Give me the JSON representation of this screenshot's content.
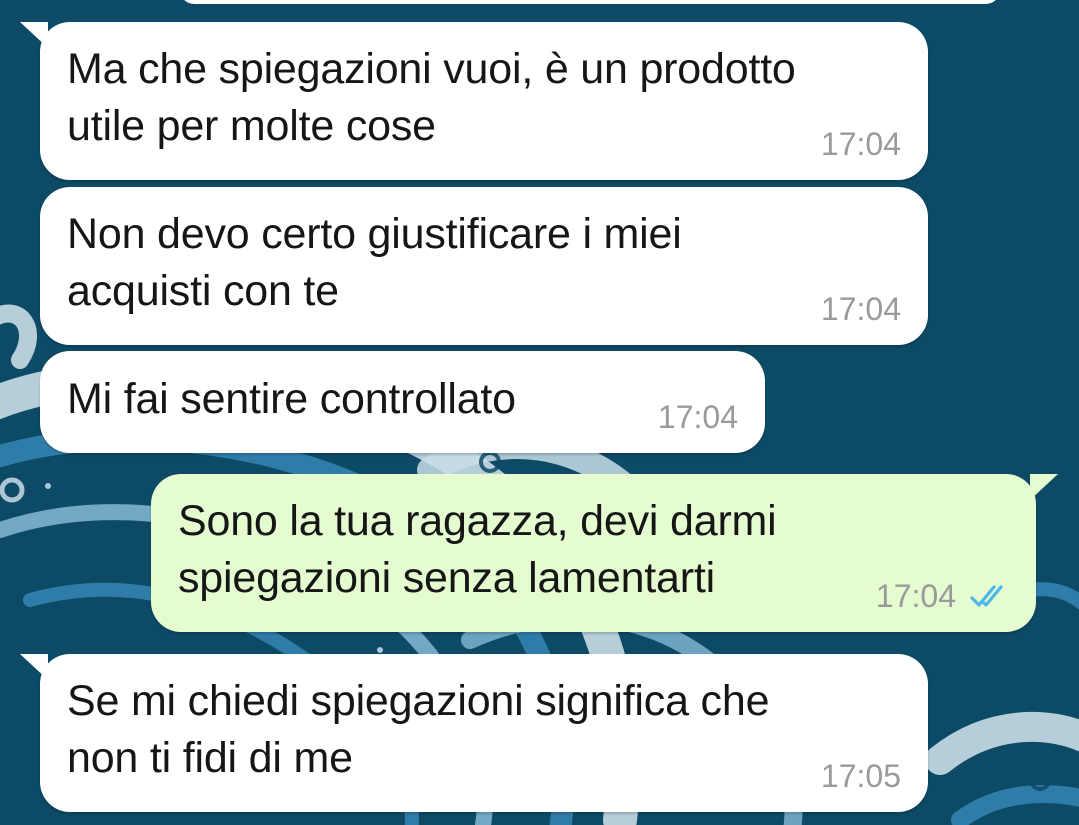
{
  "chat": {
    "messages": [
      {
        "direction": "incoming",
        "text": "Ma che spiegazioni vuoi, è un prodotto\nutile per molte cose",
        "time": "17:04"
      },
      {
        "direction": "incoming",
        "text": "Non devo certo giustificare i miei\nacquisti con te",
        "time": "17:04"
      },
      {
        "direction": "incoming",
        "text": "Mi fai sentire controllato",
        "time": "17:04"
      },
      {
        "direction": "outgoing",
        "text": "Sono la tua ragazza, devi darmi\nspiegazioni senza lamentarti",
        "time": "17:04",
        "status": "read",
        "status_icon": "double-check-icon"
      },
      {
        "direction": "incoming",
        "text": "Se mi chiedi spiegazioni significa che\nnon ti fidi di me",
        "time": "17:05"
      }
    ]
  },
  "colors": {
    "wallpaper": "#0d4a66",
    "wave_light": "#c8dde6",
    "wave_mid": "#2f7ca8",
    "incoming_bubble": "#ffffff",
    "outgoing_bubble": "#e4fccf",
    "timestamp": "#9a9a9a",
    "read_ticks": "#4fb6ec"
  }
}
